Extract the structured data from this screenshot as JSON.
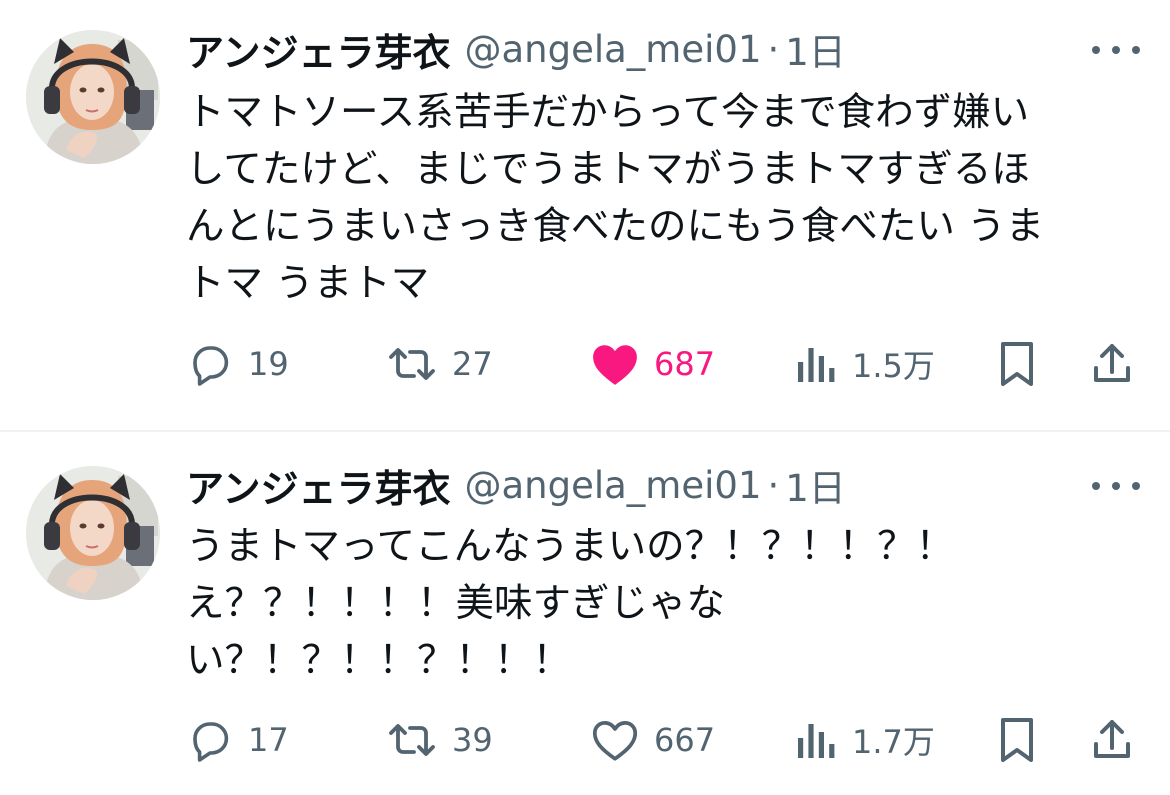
{
  "tweets": [
    {
      "name": "アンジェラ芽衣",
      "handle": "@angela_mei01",
      "separator": "·",
      "time": "1日",
      "lines": [
        "トマトソース系苦手だからって今まで食わず嫌い",
        "してたけど、まじでうまトマがうまトマすぎるほ",
        "んとにうまいさっき食べたのにもう食べたい うま",
        "トマ うまトマ"
      ],
      "replies": "19",
      "retweets": "27",
      "likes": "687",
      "liked": true,
      "views": "1.5万",
      "icons": [
        "reply-icon",
        "retweet-icon",
        "heart-filled-icon",
        "views-icon",
        "bookmark-icon",
        "share-icon",
        "more-icon"
      ]
    },
    {
      "name": "アンジェラ芽衣",
      "handle": "@angela_mei01",
      "separator": "·",
      "time": "1日",
      "lines": [
        "うまトマってこんなうまいの？！？！！？！",
        "え？？！！！！美味すぎじゃな",
        "い？！？！！？！！！"
      ],
      "replies": "17",
      "retweets": "39",
      "likes": "667",
      "liked": false,
      "views": "1.7万",
      "icons": [
        "reply-icon",
        "retweet-icon",
        "heart-outline-icon",
        "views-icon",
        "bookmark-icon",
        "share-icon",
        "more-icon"
      ]
    }
  ],
  "colors": {
    "text": "#0f1419",
    "secondary": "#536471",
    "like": "#f91880",
    "divider": "#eff3f4"
  }
}
